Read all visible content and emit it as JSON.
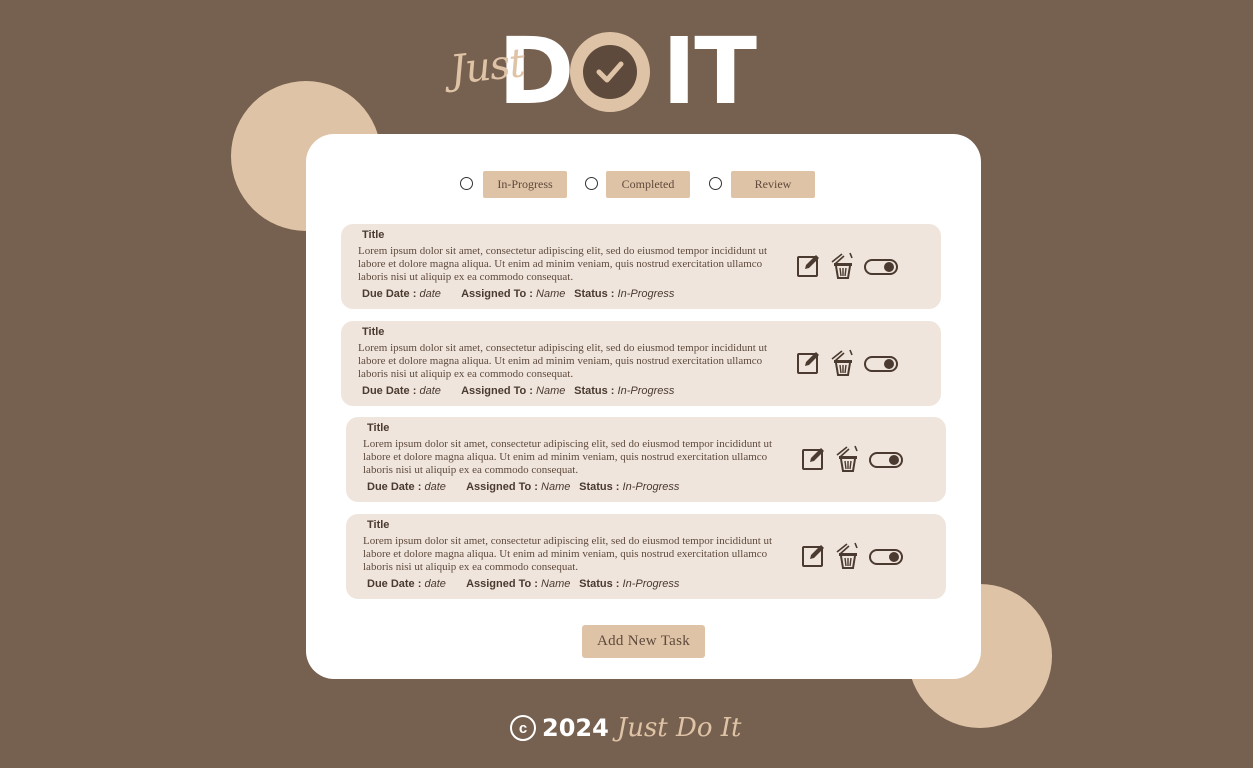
{
  "logo": {
    "just": "Just",
    "d": "D",
    "it": "IT"
  },
  "filters": [
    {
      "label": "In-Progress"
    },
    {
      "label": "Completed"
    },
    {
      "label": "Review"
    }
  ],
  "tasks": [
    {
      "title": "Title",
      "description": "Lorem ipsum dolor sit amet, consectetur adipiscing elit, sed do eiusmod tempor incididunt ut labore et dolore magna aliqua. Ut enim ad minim veniam, quis nostrud exercitation ullamco laboris nisi ut aliquip ex ea commodo consequat.",
      "due_label": "Due Date :",
      "due_value": "date",
      "assigned_label": "Assigned To :",
      "assigned_value": "Name",
      "status_label": "Status :",
      "status_value": "In-Progress"
    },
    {
      "title": "Title",
      "description": "Lorem ipsum dolor sit amet, consectetur adipiscing elit, sed do eiusmod tempor incididunt ut labore et dolore magna aliqua. Ut enim ad minim veniam, quis nostrud exercitation ullamco laboris nisi ut aliquip ex ea commodo consequat.",
      "due_label": "Due Date :",
      "due_value": "date",
      "assigned_label": "Assigned To :",
      "assigned_value": "Name",
      "status_label": "Status :",
      "status_value": "In-Progress"
    },
    {
      "title": "Title",
      "description": "Lorem ipsum dolor sit amet, consectetur adipiscing elit, sed do eiusmod tempor incididunt ut labore et dolore magna aliqua. Ut enim ad minim veniam, quis nostrud exercitation ullamco laboris nisi ut aliquip ex ea commodo consequat.",
      "due_label": "Due Date :",
      "due_value": "date",
      "assigned_label": "Assigned To :",
      "assigned_value": "Name",
      "status_label": "Status :",
      "status_value": "In-Progress"
    },
    {
      "title": "Title",
      "description": "Lorem ipsum dolor sit amet, consectetur adipiscing elit, sed do eiusmod tempor incididunt ut labore et dolore magna aliqua. Ut enim ad minim veniam, quis nostrud exercitation ullamco laboris nisi ut aliquip ex ea commodo consequat.",
      "due_label": "Due Date :",
      "due_value": "date",
      "assigned_label": "Assigned To :",
      "assigned_value": "Name",
      "status_label": "Status :",
      "status_value": "In-Progress"
    }
  ],
  "add_button": "Add  New Task",
  "footer": {
    "copyright_symbol": "c",
    "year": "2024",
    "name": "Just Do It"
  },
  "icons": [
    "checkmark-icon",
    "edit-icon",
    "trash-icon",
    "toggle-switch"
  ],
  "colors": {
    "background": "#76604f",
    "accent": "#dfc3a6",
    "card": "#ffffff",
    "task_bg": "#f0e5dc",
    "dark": "#4a3a2f"
  }
}
